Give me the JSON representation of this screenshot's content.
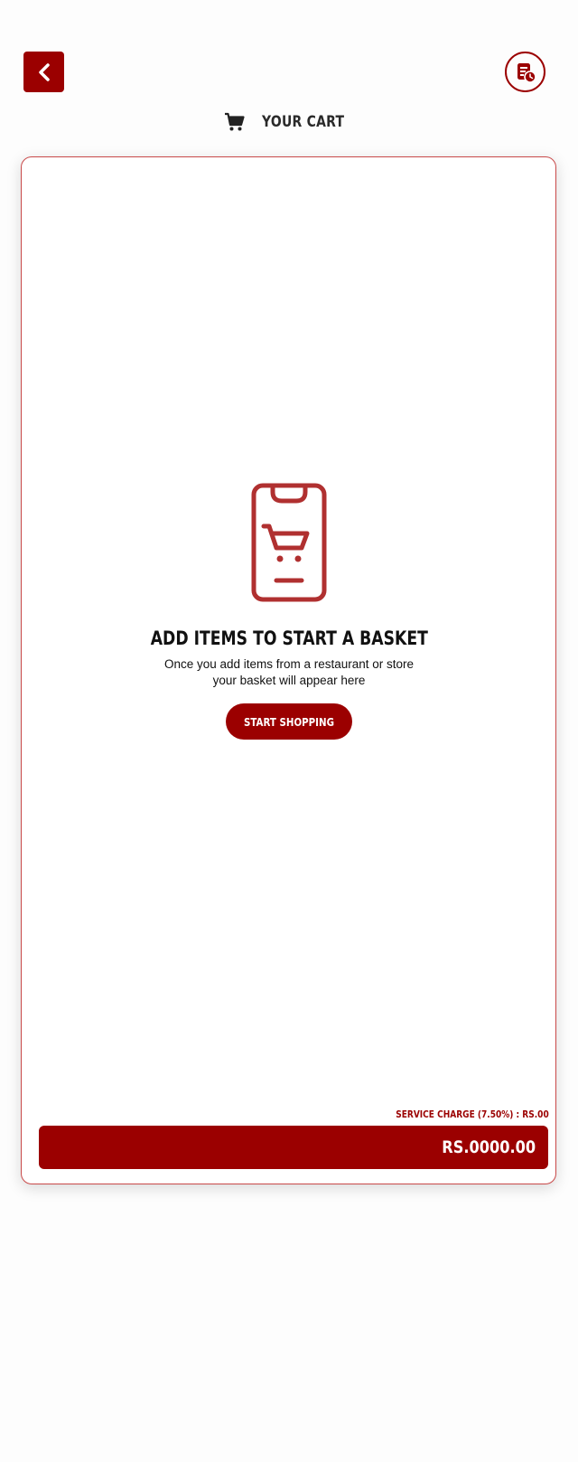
{
  "header": {
    "title": "YOUR CART",
    "back_icon": "chevron-left-icon",
    "history_icon": "order-history-icon",
    "cart_icon": "cart-icon"
  },
  "empty_state": {
    "illustration_icon": "phone-cart-icon",
    "heading": "ADD ITEMS TO START A BASKET",
    "subtext": "Once you add items from a restaurant or store your basket will appear here",
    "button_label": "START SHOPPING"
  },
  "summary": {
    "service_charge": "SERVICE CHARGE (7.50%) : RS.00",
    "total": "RS.0000.00"
  },
  "colors": {
    "accent": "#9b0000",
    "illustration": "#b03030",
    "card_border": "#c94a4a",
    "background": "#fdfdfd"
  }
}
